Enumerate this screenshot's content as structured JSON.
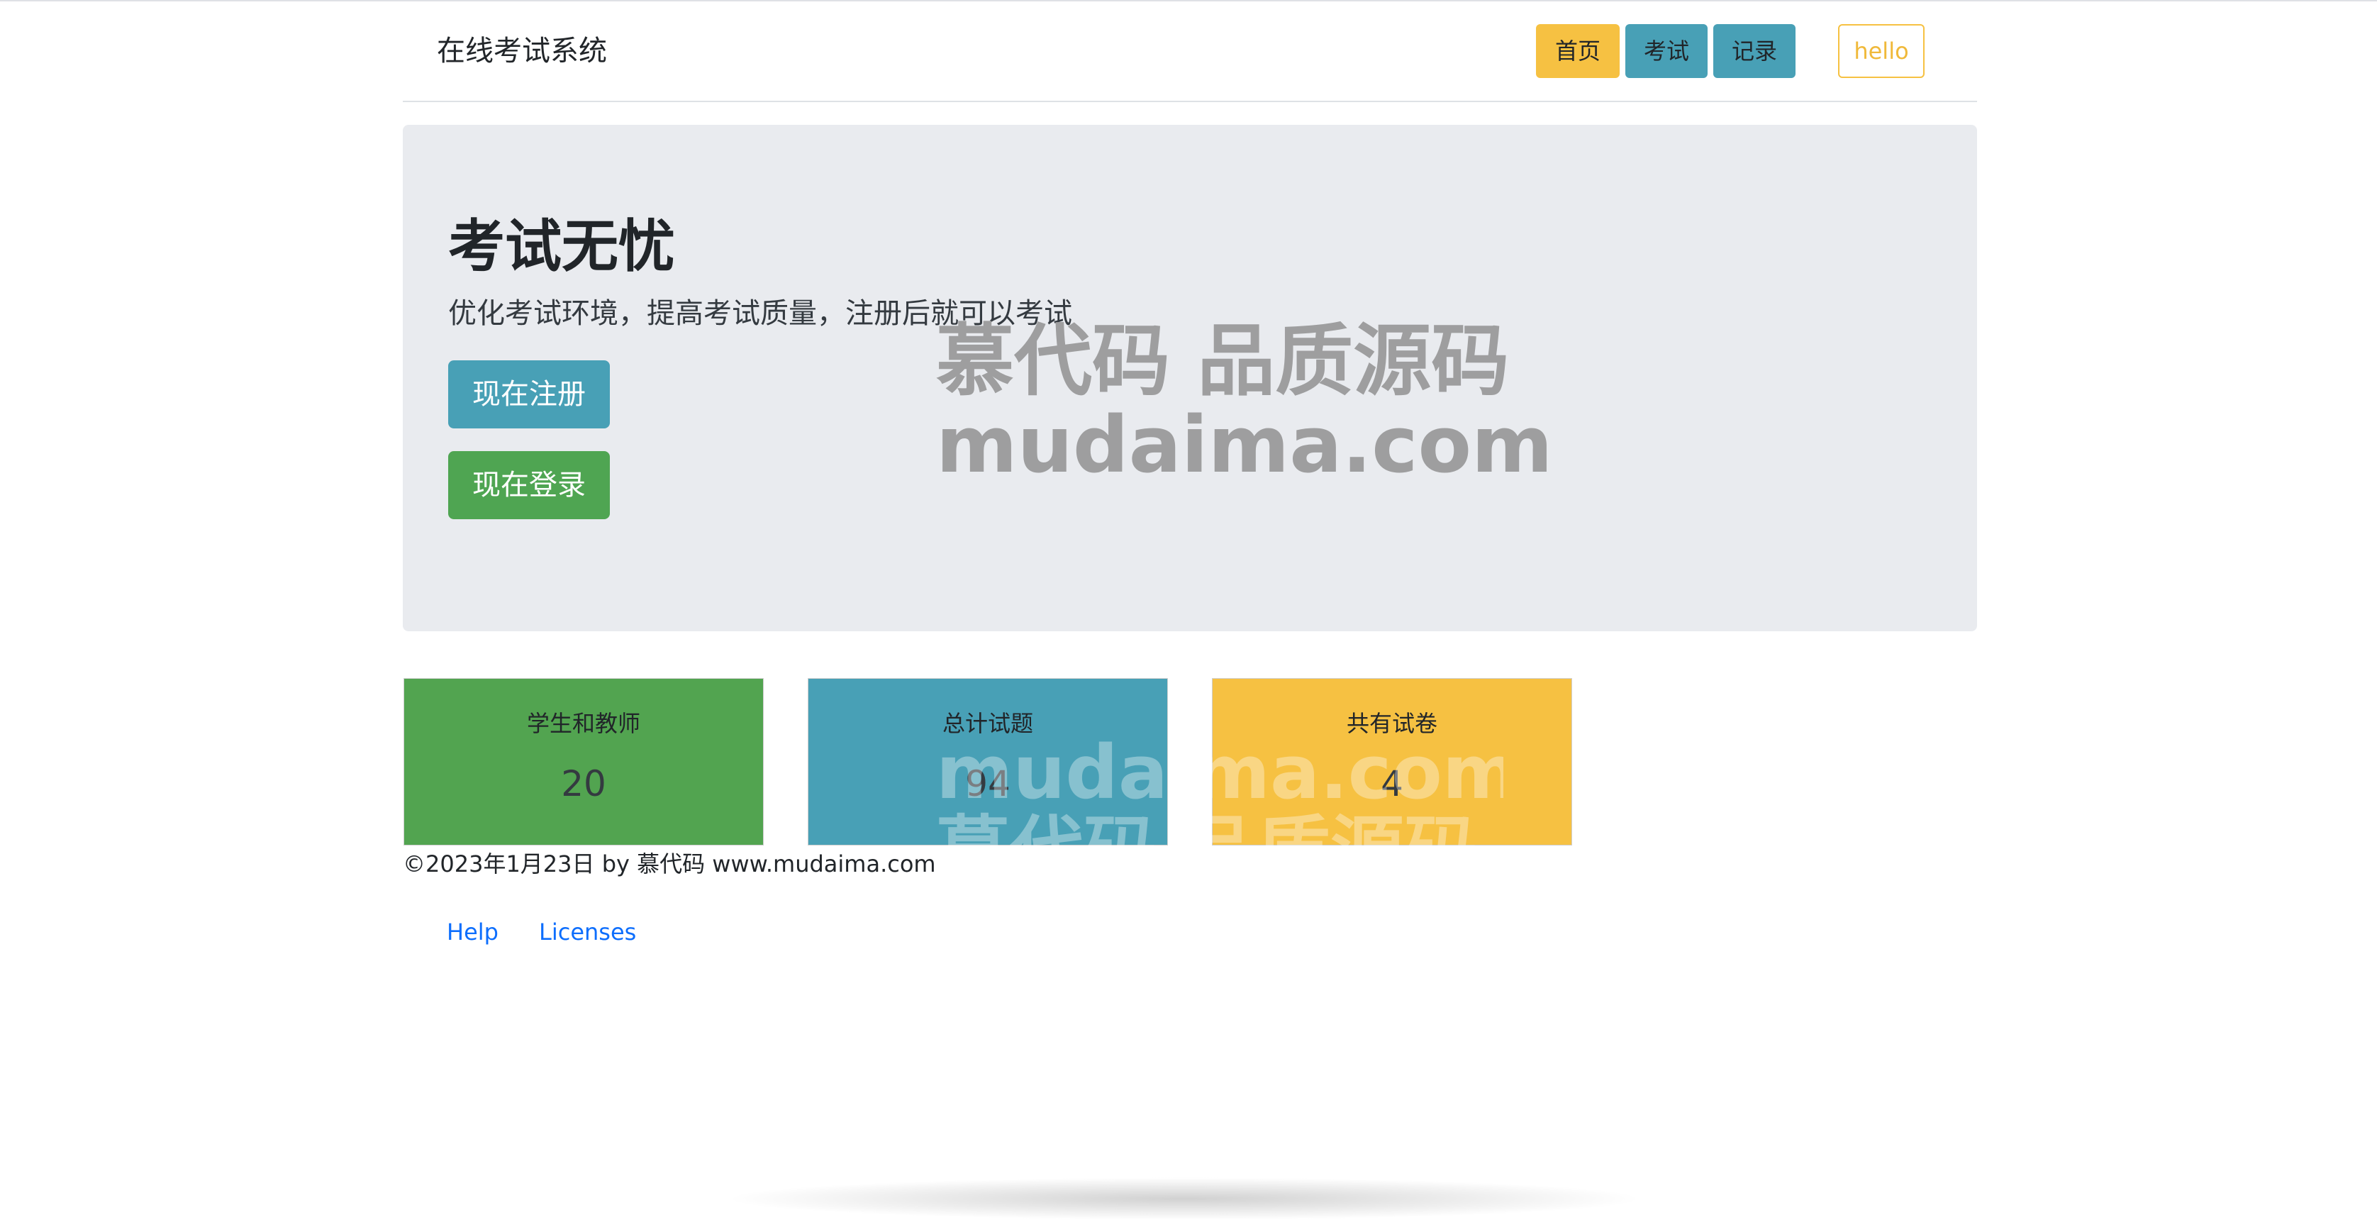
{
  "navbar": {
    "brand": "在线考试系统",
    "items": [
      {
        "label": "首页"
      },
      {
        "label": "考试"
      },
      {
        "label": "记录"
      }
    ],
    "user_label": "hello"
  },
  "hero": {
    "title": "考试无忧",
    "subtitle": "优化考试环境，提高考试质量，注册后就可以考试",
    "register_button": "现在注册",
    "login_button": "现在登录"
  },
  "watermark": {
    "line1": "慕代码 品质源码",
    "line2": "mudaima.com"
  },
  "stats": [
    {
      "label": "学生和教师",
      "value": "20",
      "color": "#52a450"
    },
    {
      "label": "总计试题",
      "value": "94",
      "color": "#48a0b6"
    },
    {
      "label": "共有试卷",
      "value": "4",
      "color": "#f6c142"
    }
  ],
  "footer": {
    "copyright": "©2023年1月23日 by 慕代码 www.mudaima.com",
    "links": [
      {
        "label": "Help"
      },
      {
        "label": "Licenses"
      }
    ]
  },
  "colors": {
    "primary_yellow": "#f6c142",
    "teal": "#48a0b6",
    "green": "#52a450",
    "hero_bg": "#e9ebef",
    "link": "#0d6efd"
  }
}
